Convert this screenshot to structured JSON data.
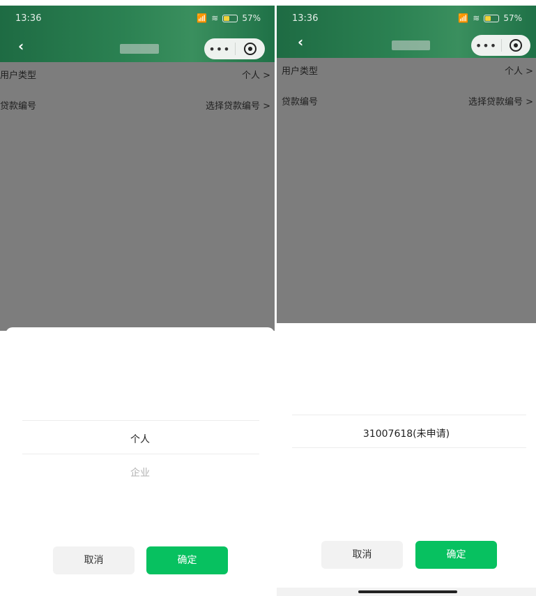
{
  "status": {
    "time": "13:36",
    "signal": "📶",
    "wifi": "≋",
    "battery": "57%"
  },
  "nav": {
    "back": "‹",
    "more": "•••"
  },
  "rows": [
    {
      "label": "用户类型",
      "value": "个人 >"
    },
    {
      "label": "贷款编号",
      "value": "选择贷款编号 >"
    }
  ],
  "left_picker": {
    "options": [
      "个人",
      "企业"
    ],
    "selected": "个人"
  },
  "right_picker": {
    "options": [
      "31007618(未申请)"
    ],
    "selected": "31007618(未申请)"
  },
  "buttons": {
    "cancel": "取消",
    "confirm": "确定"
  },
  "colors": {
    "header": "#2b8152",
    "confirm": "#07c160",
    "overlay": "#7d7d7d"
  }
}
